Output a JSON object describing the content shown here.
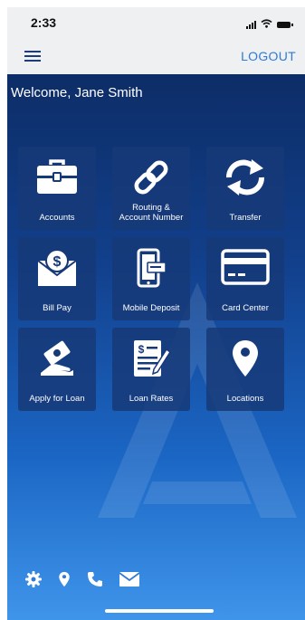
{
  "status_bar": {
    "time": "2:33"
  },
  "navbar": {
    "logout_label": "LOGOUT"
  },
  "welcome_text": "Welcome, Jane Smith",
  "tiles": [
    {
      "label": "Accounts",
      "icon": "briefcase-icon"
    },
    {
      "label": "Routing &\nAccount Number",
      "icon": "link-icon"
    },
    {
      "label": "Transfer",
      "icon": "transfer-icon"
    },
    {
      "label": "Bill Pay",
      "icon": "bill-pay-icon"
    },
    {
      "label": "Mobile Deposit",
      "icon": "mobile-deposit-icon"
    },
    {
      "label": "Card Center",
      "icon": "credit-card-icon"
    },
    {
      "label": "Apply for Loan",
      "icon": "loan-money-icon"
    },
    {
      "label": "Loan Rates",
      "icon": "loan-rates-icon"
    },
    {
      "label": "Locations",
      "icon": "location-pin-icon"
    }
  ],
  "bottom_icons": [
    "gear-icon",
    "location-pin-icon",
    "phone-icon",
    "mail-icon"
  ],
  "colors": {
    "accent": "#2f7ad6",
    "background_top": "#0d2d67",
    "background_bottom": "#3f95ea",
    "tile": "#163978"
  }
}
